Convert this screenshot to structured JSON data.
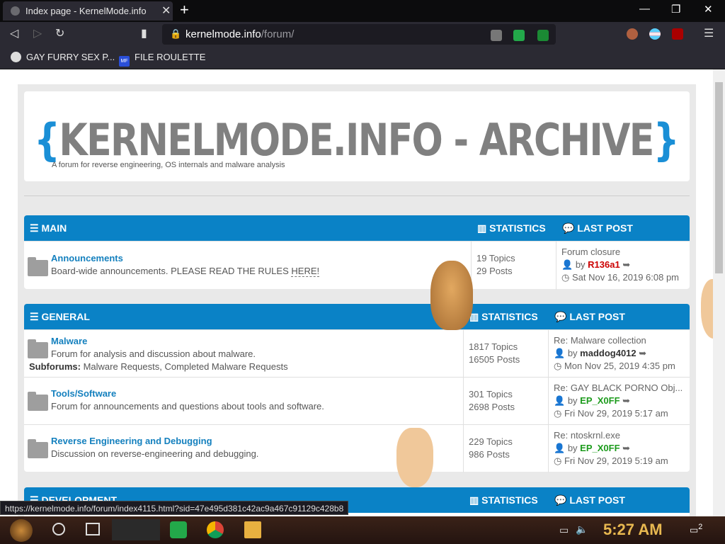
{
  "browser": {
    "tab_title": "Index page - KernelMode.info",
    "tab_close": "✕",
    "new_tab": "+",
    "url_domain": "kernelmode.info",
    "url_path": "/forum/",
    "window_controls": [
      "—",
      "❐",
      "✕"
    ],
    "bookmarks": [
      {
        "label": "GAY FURRY SEX P..."
      },
      {
        "label": "FILE ROULETTE",
        "icon_text": "MF"
      }
    ]
  },
  "site": {
    "logo_open": "{",
    "logo_text": "KERNELMODE.INFO - ARCHIVE",
    "logo_close": "}",
    "tagline": "A forum for reverse engineering, OS internals and malware analysis"
  },
  "categories": [
    {
      "name": "MAIN",
      "stats_label": "STATISTICS",
      "lastpost_label": "LAST POST",
      "forums": [
        {
          "name": "Announcements",
          "desc": "Board-wide announcements. PLEASE READ THE RULES",
          "desc_link": "HERE!",
          "topics": "19 Topics",
          "posts": "29 Posts",
          "last_title": "Forum closure",
          "last_by": "by",
          "last_user": "R136a1",
          "last_user_color": "#cc0000",
          "last_date": "Sat Nov 16, 2019 6:08 pm"
        }
      ]
    },
    {
      "name": "GENERAL",
      "stats_label": "STATISTICS",
      "lastpost_label": "LAST POST",
      "forums": [
        {
          "name": "Malware",
          "desc": "Forum for analysis and discussion about malware.",
          "subforums_label": "Subforums:",
          "subforums": "Malware Requests, Completed Malware Requests",
          "topics": "1817 Topics",
          "posts": "16505 Posts",
          "last_title": "Re: Malware collection",
          "last_by": "by",
          "last_user": "maddog4012",
          "last_user_color": "#333333",
          "last_date": "Mon Nov 25, 2019 4:35 pm"
        },
        {
          "name": "Tools/Software",
          "desc": "Forum for announcements and questions about tools and software.",
          "topics": "301 Topics",
          "posts": "2698 Posts",
          "last_title": "Re: GAY BLACK PORNO Obj...",
          "last_by": "by",
          "last_user": "EP_X0FF",
          "last_user_color": "#1c9b1c",
          "last_date": "Fri Nov 29, 2019 5:17 am"
        },
        {
          "name": "Reverse Engineering and Debugging",
          "desc": "Discussion on reverse-engineering and debugging.",
          "topics": "229 Topics",
          "posts": "986 Posts",
          "last_title": "Re: ntoskrnl.exe",
          "last_by": "by",
          "last_user": "EP_X0FF",
          "last_user_color": "#1c9b1c",
          "last_date": "Fri Nov 29, 2019 5:19 am"
        }
      ]
    },
    {
      "name": "DEVELOPMENT",
      "stats_label": "STATISTICS",
      "lastpost_label": "LAST POST"
    }
  ],
  "status_url": "https://kernelmode.info/forum/index4115.html?sid=47e495d381c42ac9a467c91129c428b8",
  "taskbar": {
    "time": "5:27 AM",
    "notif_count": "2"
  },
  "colors": {
    "accent": "#0a82c6",
    "link": "#1480be"
  }
}
